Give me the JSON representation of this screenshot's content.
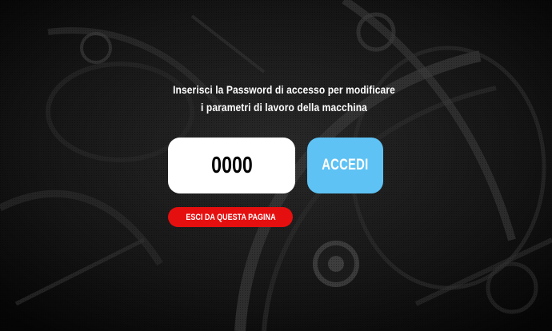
{
  "login": {
    "prompt_line1": "Inserisci la Password di accesso per modificare",
    "prompt_line2": "i parametri di lavoro della macchina",
    "password_value": "0000",
    "accedi_label": "ACCEDI",
    "exit_label": "ESCI DA QUESTA PAGINA"
  },
  "colors": {
    "background": "#0e0e0e",
    "password_box": "#ffffff",
    "accedi_button": "#5ec2f4",
    "exit_button": "#e60f0f",
    "text": "#ffffff"
  },
  "background_image": {
    "icon": "machinery-gears-background"
  }
}
